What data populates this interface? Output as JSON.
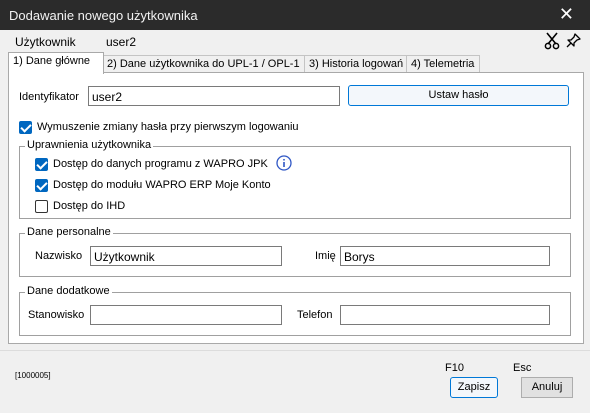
{
  "window": {
    "title": "Dodawanie nowego użytkownika",
    "close_glyph": "✕"
  },
  "userbar": {
    "label": "Użytkownik",
    "value": "user2",
    "icons": [
      "scissors-icon",
      "pin-icon"
    ]
  },
  "tabs": [
    {
      "label": "1) Dane główne",
      "active": true
    },
    {
      "label": "2) Dane użytkownika do UPL-1 / OPL-1",
      "active": false
    },
    {
      "label": "3) Historia logowań",
      "active": false
    },
    {
      "label": "4) Telemetria",
      "active": false
    }
  ],
  "main": {
    "identifier_label": "Identyfikator",
    "identifier_value": "user2",
    "set_password_button": "Ustaw hasło",
    "force_password_change": {
      "label": "Wymuszenie zmiany hasła przy pierwszym logowaniu",
      "checked": true
    },
    "permissions": {
      "legend": "Uprawnienia użytkownika",
      "items": [
        {
          "label": "Dostęp do danych programu z WAPRO JPK",
          "checked": true,
          "info_icon": "info-icon"
        },
        {
          "label": "Dostęp do modułu WAPRO ERP Moje Konto",
          "checked": true
        },
        {
          "label": "Dostęp do IHD",
          "checked": false
        }
      ]
    },
    "personal": {
      "legend": "Dane personalne",
      "surname_label": "Nazwisko",
      "surname_value": "Użytkownik",
      "name_label": "Imię",
      "name_value": "Borys"
    },
    "additional": {
      "legend": "Dane dodatkowe",
      "position_label": "Stanowisko",
      "position_value": "",
      "phone_label": "Telefon",
      "phone_value": ""
    }
  },
  "footer": {
    "code": "[1000005]",
    "save_shortcut": "F10",
    "save_label": "Zapisz",
    "cancel_shortcut": "Esc",
    "cancel_label": "Anuluj"
  },
  "colors": {
    "titlebar": "#2b2b2b",
    "accent": "#0067c0",
    "primary_border": "#0078d7"
  }
}
